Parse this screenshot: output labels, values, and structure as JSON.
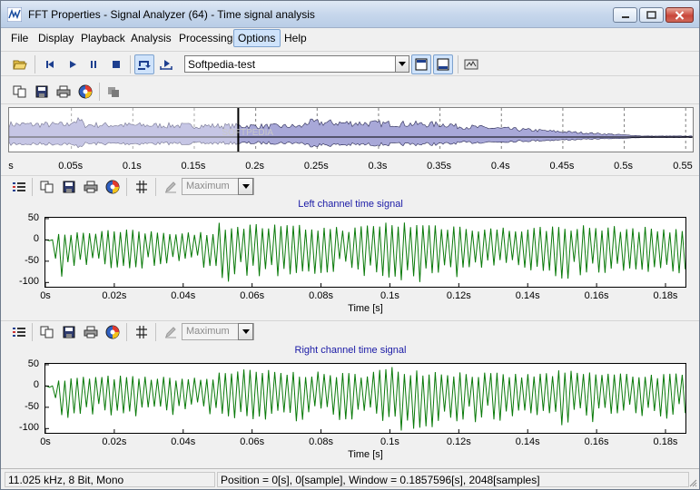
{
  "window": {
    "title": "FFT Properties - Signal Analyzer (64) - Time signal analysis",
    "icon": "signal-analyzer-app-icon"
  },
  "menu": [
    "File",
    "Display",
    "Playback",
    "Analysis",
    "Processing",
    "Options",
    "Help"
  ],
  "menu_active": "Options",
  "toolbar": {
    "source_select": "Softpedia-test",
    "icons": [
      "open-folder-icon",
      "skip-to-start-icon",
      "play-icon",
      "pause-icon",
      "stop-icon",
      "loop-icon",
      "play-selection-icon",
      "layout-split-icon",
      "layout-single-icon",
      "screenshot-icon"
    ]
  },
  "toolbar2": {
    "icons": [
      "copy-icon",
      "save-icon",
      "print-icon",
      "color-palette-icon",
      "copy-disabled-icon"
    ]
  },
  "overview": {
    "ticks": [
      "s",
      "0.05s",
      "0.1s",
      "0.15s",
      "0.2s",
      "0.25s",
      "0.3s",
      "0.35s",
      "0.4s",
      "0.45s",
      "0.5s",
      "0.55"
    ],
    "selection_end_seconds": 0.1858,
    "watermark": "SOFTPEDIA"
  },
  "chart_toolbar": {
    "mode_select": "Maximum"
  },
  "chart_data": [
    {
      "type": "line",
      "title": "Left channel time signal",
      "xlabel": "Time [s]",
      "ylabel": "",
      "x_ticks": [
        "0s",
        "0.02s",
        "0.04s",
        "0.06s",
        "0.08s",
        "0.1s",
        "0.12s",
        "0.14s",
        "0.16s",
        "0.18s"
      ],
      "y_ticks": [
        "50",
        "0",
        "-50",
        "-100"
      ],
      "xlim": [
        0,
        0.1858
      ],
      "ylim": [
        -110,
        52
      ],
      "color": "#0a7a0a",
      "envelope": [
        {
          "t": 0.0,
          "max": 0,
          "min": 0
        },
        {
          "t": 0.002,
          "max": 0,
          "min": -5
        },
        {
          "t": 0.004,
          "max": 15,
          "min": -85
        },
        {
          "t": 0.01,
          "max": 22,
          "min": -75
        },
        {
          "t": 0.02,
          "max": 24,
          "min": -72
        },
        {
          "t": 0.03,
          "max": 22,
          "min": -70
        },
        {
          "t": 0.04,
          "max": 20,
          "min": -68
        },
        {
          "t": 0.049,
          "max": 18,
          "min": -65
        },
        {
          "t": 0.05,
          "max": 40,
          "min": -95
        },
        {
          "t": 0.06,
          "max": 38,
          "min": -90
        },
        {
          "t": 0.07,
          "max": 35,
          "min": -85
        },
        {
          "t": 0.08,
          "max": 32,
          "min": -80
        },
        {
          "t": 0.09,
          "max": 30,
          "min": -78
        },
        {
          "t": 0.1,
          "max": 45,
          "min": -110
        },
        {
          "t": 0.11,
          "max": 40,
          "min": -95
        },
        {
          "t": 0.12,
          "max": 35,
          "min": -88
        },
        {
          "t": 0.13,
          "max": 30,
          "min": -80
        },
        {
          "t": 0.14,
          "max": 28,
          "min": -76
        },
        {
          "t": 0.15,
          "max": 36,
          "min": -88
        },
        {
          "t": 0.16,
          "max": 33,
          "min": -82
        },
        {
          "t": 0.17,
          "max": 30,
          "min": -78
        },
        {
          "t": 0.1858,
          "max": 28,
          "min": -75
        }
      ]
    },
    {
      "type": "line",
      "title": "Right channel time signal",
      "xlabel": "Time [s]",
      "ylabel": "",
      "x_ticks": [
        "0s",
        "0.02s",
        "0.04s",
        "0.06s",
        "0.08s",
        "0.1s",
        "0.12s",
        "0.14s",
        "0.16s",
        "0.18s"
      ],
      "y_ticks": [
        "50",
        "0",
        "-50",
        "-100"
      ],
      "xlim": [
        0,
        0.1858
      ],
      "ylim": [
        -110,
        52
      ],
      "color": "#0a7a0a",
      "envelope": [
        {
          "t": 0.0,
          "max": 0,
          "min": 0
        },
        {
          "t": 0.002,
          "max": 0,
          "min": -5
        },
        {
          "t": 0.004,
          "max": 15,
          "min": -85
        },
        {
          "t": 0.01,
          "max": 22,
          "min": -75
        },
        {
          "t": 0.02,
          "max": 24,
          "min": -72
        },
        {
          "t": 0.03,
          "max": 22,
          "min": -70
        },
        {
          "t": 0.04,
          "max": 20,
          "min": -68
        },
        {
          "t": 0.049,
          "max": 18,
          "min": -65
        },
        {
          "t": 0.05,
          "max": 40,
          "min": -95
        },
        {
          "t": 0.06,
          "max": 38,
          "min": -90
        },
        {
          "t": 0.07,
          "max": 35,
          "min": -85
        },
        {
          "t": 0.08,
          "max": 32,
          "min": -80
        },
        {
          "t": 0.09,
          "max": 30,
          "min": -78
        },
        {
          "t": 0.1,
          "max": 45,
          "min": -110
        },
        {
          "t": 0.11,
          "max": 40,
          "min": -95
        },
        {
          "t": 0.12,
          "max": 35,
          "min": -88
        },
        {
          "t": 0.13,
          "max": 30,
          "min": -80
        },
        {
          "t": 0.14,
          "max": 28,
          "min": -76
        },
        {
          "t": 0.15,
          "max": 36,
          "min": -88
        },
        {
          "t": 0.16,
          "max": 33,
          "min": -82
        },
        {
          "t": 0.17,
          "max": 30,
          "min": -78
        },
        {
          "t": 0.1858,
          "max": 28,
          "min": -75
        }
      ]
    }
  ],
  "status": {
    "format": "11.025 kHz, 8 Bit, Mono",
    "position": "Position = 0[s], 0[sample], Window = 0.1857596[s], 2048[samples]"
  },
  "colors": {
    "waveform": "#0a7a0a",
    "overview_fill": "#a8a8d8",
    "chart_title": "#1a1aa6",
    "accent": "#cfe3fb"
  }
}
